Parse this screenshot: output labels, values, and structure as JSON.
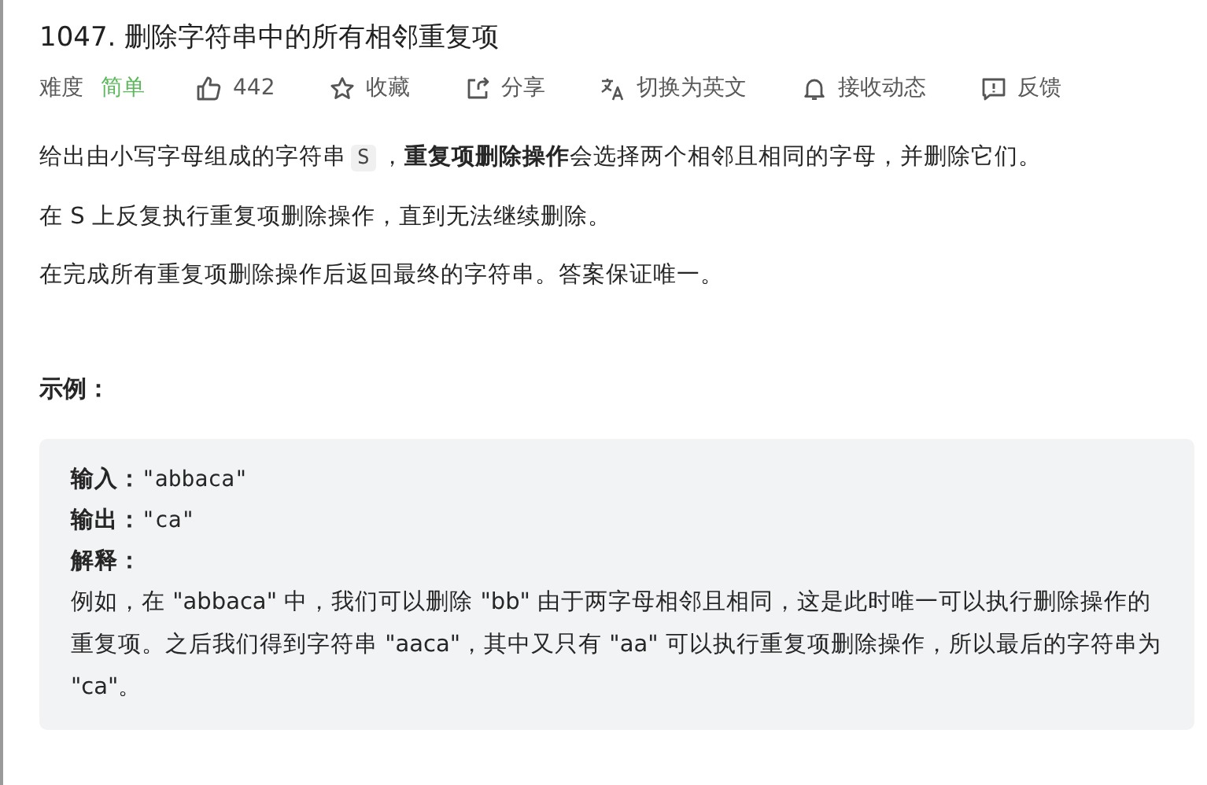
{
  "title": "1047. 删除字符串中的所有相邻重复项",
  "difficulty": {
    "label": "难度",
    "value": "简单",
    "color": "#5cb85c"
  },
  "actions": [
    {
      "kind": "like",
      "label": "442"
    },
    {
      "kind": "star",
      "label": "收藏"
    },
    {
      "kind": "share",
      "label": "分享"
    },
    {
      "kind": "translate",
      "label": "切换为英文"
    },
    {
      "kind": "bell",
      "label": "接收动态"
    },
    {
      "kind": "feedback",
      "label": "反馈"
    }
  ],
  "description": [
    {
      "before": "给出由小写字母组成的字符串",
      "code": "S",
      "after": "，**重复项删除操作**会选择两个相邻且相同的字母，并删除它们。"
    },
    {
      "before": "在 S 上反复执行重复项删除操作，直到无法继续删除。"
    },
    {
      "before": "在完成所有重复项删除操作后返回最终的字符串。答案保证唯一。"
    }
  ],
  "example": {
    "heading": "示例：",
    "lines": [
      {
        "label": "输入：",
        "value": "\"abbaca\""
      },
      {
        "label": "输出：",
        "value": "\"ca\""
      },
      {
        "label": "解释："
      }
    ],
    "explanation": "例如，在 \"abbaca\" 中，我们可以删除 \"bb\" 由于两字母相邻且相同，这是此时唯一可以执行删除操作的重复项。之后我们得到字符串 \"aaca\"，其中又只有 \"aa\" 可以执行重复项删除操作，所以最后的字符串为 \"ca\"。"
  }
}
